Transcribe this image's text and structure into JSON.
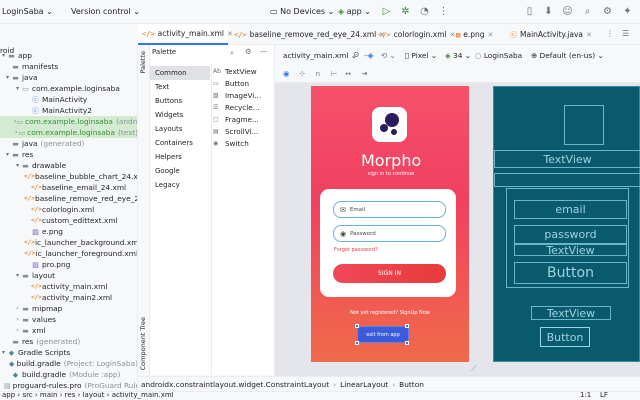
{
  "topbar": {
    "project": "LoginSaba",
    "vcs": "Version control",
    "device": "No Devices",
    "run_config": "app"
  },
  "tabs": [
    {
      "label": "activity_main.xml",
      "active": true
    },
    {
      "label": "baseline_remove_red_eye_24.xml",
      "active": false
    },
    {
      "label": "colorlogin.xml",
      "active": false
    },
    {
      "label": "e.png",
      "active": false
    },
    {
      "label": "MainActivity.java",
      "active": false
    }
  ],
  "tree": {
    "header": "roid",
    "items": [
      {
        "label": "app",
        "indent": 0,
        "arrow": "▾",
        "icon": "folder"
      },
      {
        "label": "manifests",
        "indent": 1,
        "arrow": "",
        "icon": "folder"
      },
      {
        "label": "java",
        "indent": 1,
        "arrow": "▾",
        "icon": "folder"
      },
      {
        "label": "com.example.loginsaba",
        "indent": 2,
        "arrow": "▾",
        "icon": "package"
      },
      {
        "label": "MainActivity",
        "indent": 3,
        "arrow": "",
        "icon": "class"
      },
      {
        "label": "MainActivity2",
        "indent": 3,
        "arrow": "",
        "icon": "class"
      },
      {
        "label": "com.example.loginsaba",
        "suffix": "(android",
        "indent": 2,
        "arrow": "›",
        "icon": "package",
        "hl": "green"
      },
      {
        "label": "com.example.loginsaba",
        "suffix": "(test)",
        "indent": 2,
        "arrow": "›",
        "icon": "package",
        "hl": "green"
      },
      {
        "label": "java",
        "suffix": "(generated)",
        "indent": 1,
        "arrow": "",
        "icon": "folder"
      },
      {
        "label": "res",
        "indent": 1,
        "arrow": "▾",
        "icon": "folder"
      },
      {
        "label": "drawable",
        "indent": 2,
        "arrow": "▾",
        "icon": "folder"
      },
      {
        "label": "baseline_bubble_chart_24.xml",
        "indent": 3,
        "arrow": "",
        "icon": "xml"
      },
      {
        "label": "baseline_email_24.xml",
        "indent": 3,
        "arrow": "",
        "icon": "xml"
      },
      {
        "label": "baseline_remove_red_eye_24.xml",
        "indent": 3,
        "arrow": "",
        "icon": "xml"
      },
      {
        "label": "colorlogin.xml",
        "indent": 3,
        "arrow": "",
        "icon": "xml"
      },
      {
        "label": "custom_edittext.xml",
        "indent": 3,
        "arrow": "",
        "icon": "xml"
      },
      {
        "label": "e.png",
        "indent": 3,
        "arrow": "",
        "icon": "png"
      },
      {
        "label": "ic_launcher_background.xml",
        "indent": 3,
        "arrow": "",
        "icon": "xml"
      },
      {
        "label": "ic_launcher_foreground.xml",
        "indent": 3,
        "arrow": "",
        "icon": "xml"
      },
      {
        "label": "pro.png",
        "indent": 3,
        "arrow": "",
        "icon": "png"
      },
      {
        "label": "layout",
        "indent": 2,
        "arrow": "▾",
        "icon": "folder"
      },
      {
        "label": "activity_main.xml",
        "indent": 3,
        "arrow": "",
        "icon": "xml"
      },
      {
        "label": "activity_main2.xml",
        "indent": 3,
        "arrow": "",
        "icon": "xml"
      },
      {
        "label": "mipmap",
        "indent": 2,
        "arrow": "›",
        "icon": "folder"
      },
      {
        "label": "values",
        "indent": 2,
        "arrow": "›",
        "icon": "folder"
      },
      {
        "label": "xml",
        "indent": 2,
        "arrow": "›",
        "icon": "folder"
      },
      {
        "label": "res",
        "suffix": "(generated)",
        "indent": 1,
        "arrow": "",
        "icon": "folder"
      },
      {
        "label": "Gradle Scripts",
        "indent": 0,
        "arrow": "▾",
        "icon": "gradle"
      },
      {
        "label": "build.gradle",
        "suffix": "(Project: LoginSaba)",
        "indent": 1,
        "arrow": "",
        "icon": "gradle"
      },
      {
        "label": "build.gradle",
        "suffix": "(Module :app)",
        "indent": 1,
        "arrow": "",
        "icon": "gradle"
      },
      {
        "label": "proguard-rules.pro",
        "suffix": "(ProGuard Rule",
        "indent": 1,
        "arrow": "",
        "icon": "file"
      }
    ]
  },
  "sidestrip": {
    "palette": "Palette",
    "component_tree": "Component Tree"
  },
  "palette": {
    "header": "Palette",
    "categories": [
      "Common",
      "Text",
      "Buttons",
      "Widgets",
      "Layouts",
      "Containers",
      "Helpers",
      "Google",
      "Legacy"
    ],
    "items": [
      {
        "icon": "Ab",
        "label": "TextView"
      },
      {
        "icon": "▭",
        "label": "Button"
      },
      {
        "icon": "▨",
        "label": "ImageVi..."
      },
      {
        "icon": "☰",
        "label": "Recycle..."
      },
      {
        "icon": "▢",
        "label": "Fragme..."
      },
      {
        "icon": "▤",
        "label": "ScrollVi..."
      },
      {
        "icon": "◉",
        "label": "Switch"
      }
    ]
  },
  "editor_toolbar": {
    "file": "activity_main.xml",
    "device": "Pixel",
    "api": "34",
    "theme": "LoginSaba",
    "locale": "Default (en-us)"
  },
  "phone": {
    "title": "Morpho",
    "subtitle": "sign in to continue",
    "email_hint": "Email",
    "password_hint": "Password",
    "forgot": "Forgot password?",
    "signin": "SIGN IN",
    "not_registered": "Not yet registered? SignUp Now",
    "exit": "exit from app"
  },
  "blueprint": {
    "textview1": "TextView",
    "email": "email",
    "password": "password",
    "textview2": "TextView",
    "button1": "Button",
    "textview3": "TextView",
    "button2": "Button"
  },
  "breadcrumb": [
    "androidx.constraintlayout.widget.ConstraintLayout",
    "LinearLayout",
    "Button"
  ],
  "status": {
    "path": [
      "app",
      "src",
      "main",
      "res",
      "layout",
      "activity_main.xml"
    ],
    "position": "1:1",
    "encoding": "LF"
  }
}
